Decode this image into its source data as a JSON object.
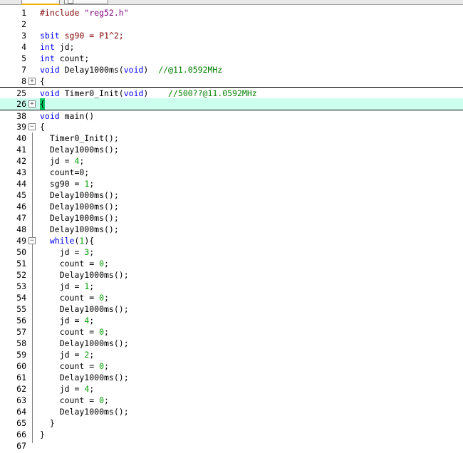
{
  "lines": [
    {
      "n": "1",
      "t": "#include \"reg52.h\""
    },
    {
      "n": "2",
      "t": ""
    },
    {
      "n": "3",
      "t": "sbit sg90 = P1^2;"
    },
    {
      "n": "4",
      "t": "int jd;"
    },
    {
      "n": "5",
      "t": "int count;"
    },
    {
      "n": "7",
      "t": "void Delay1000ms(void)  //@11.0592MHz"
    },
    {
      "n": "8",
      "t": "{"
    },
    {
      "n": "25",
      "t": "void Timer0_Init(void)    //500??@11.0592MHz"
    },
    {
      "n": "26",
      "t": "{"
    },
    {
      "n": "38",
      "t": "void main()"
    },
    {
      "n": "39",
      "t": "{"
    },
    {
      "n": "40",
      "t": "  Timer0_Init();"
    },
    {
      "n": "41",
      "t": "  Delay1000ms();"
    },
    {
      "n": "42",
      "t": "  jd = 4;"
    },
    {
      "n": "43",
      "t": "  count=0;"
    },
    {
      "n": "44",
      "t": "  sg90 = 1;"
    },
    {
      "n": "45",
      "t": "  Delay1000ms();"
    },
    {
      "n": "46",
      "t": "  Delay1000ms();"
    },
    {
      "n": "47",
      "t": "  Delay1000ms();"
    },
    {
      "n": "48",
      "t": "  Delay1000ms();"
    },
    {
      "n": "49",
      "t": "  while(1){"
    },
    {
      "n": "50",
      "t": "    jd = 3;"
    },
    {
      "n": "51",
      "t": "    count = 0;"
    },
    {
      "n": "52",
      "t": "    Delay1000ms();"
    },
    {
      "n": "53",
      "t": "    jd = 1;"
    },
    {
      "n": "54",
      "t": "    count = 0;"
    },
    {
      "n": "55",
      "t": "    Delay1000ms();"
    },
    {
      "n": "56",
      "t": "    jd = 4;"
    },
    {
      "n": "57",
      "t": "    count = 0;"
    },
    {
      "n": "58",
      "t": "    Delay1000ms();"
    },
    {
      "n": "59",
      "t": "    jd = 2;"
    },
    {
      "n": "60",
      "t": "    count = 0;"
    },
    {
      "n": "61",
      "t": "    Delay1000ms();"
    },
    {
      "n": "62",
      "t": "    jd = 4;"
    },
    {
      "n": "63",
      "t": "    count = 0;"
    },
    {
      "n": "64",
      "t": "    Delay1000ms();"
    },
    {
      "n": "65",
      "t": "  }"
    },
    {
      "n": "66",
      "t": "}"
    },
    {
      "n": "67",
      "t": ""
    }
  ],
  "colors": {
    "keyword": "#0000ff",
    "number": "#00a000",
    "string": "#800080",
    "comment": "#008000",
    "current_line": "#ccffee"
  }
}
